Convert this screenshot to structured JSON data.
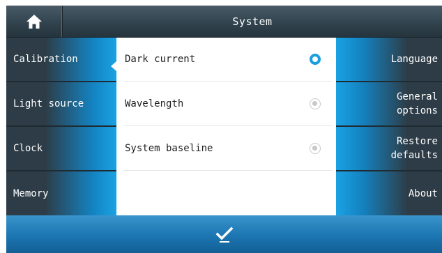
{
  "header": {
    "title": "System",
    "home_icon": "home-icon"
  },
  "left_menu": {
    "items": [
      {
        "label": "Calibration",
        "active": true
      },
      {
        "label": "Light source",
        "active": false
      },
      {
        "label": "Clock",
        "active": false
      },
      {
        "label": "Memory",
        "active": false
      }
    ]
  },
  "right_menu": {
    "items": [
      {
        "label": "Language"
      },
      {
        "label": "General options"
      },
      {
        "label": "Restore defaults"
      },
      {
        "label": "About"
      }
    ]
  },
  "calibration_options": {
    "items": [
      {
        "label": "Dark current",
        "selected": true
      },
      {
        "label": "Wavelength",
        "selected": false
      },
      {
        "label": "System baseline",
        "selected": false
      }
    ]
  },
  "footer": {
    "confirm_icon": "checkmark-icon"
  },
  "colors": {
    "accent": "#1a9ee2",
    "header_dark": "#2d3c46",
    "confirm_bar": "#1d78b4"
  }
}
